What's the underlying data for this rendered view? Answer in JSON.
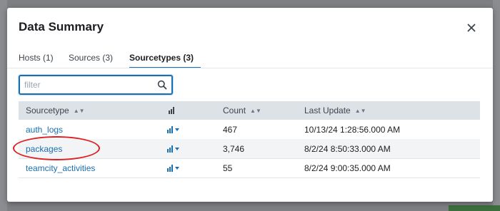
{
  "modal": {
    "title": "Data Summary",
    "tabs": [
      {
        "label": "Hosts (1)",
        "active": false
      },
      {
        "label": "Sources (3)",
        "active": false
      },
      {
        "label": "Sourcetypes (3)",
        "active": true
      }
    ],
    "filter": {
      "placeholder": "filter",
      "value": ""
    }
  },
  "table": {
    "headers": [
      "Sourcetype",
      "Count",
      "Last Update"
    ],
    "rows": [
      {
        "sourcetype": "auth_logs",
        "count": "467",
        "last_update": "10/13/24 1:28:56.000 AM"
      },
      {
        "sourcetype": "packages",
        "count": "3,746",
        "last_update": "8/2/24 8:50:33.000 AM",
        "highlighted": true
      },
      {
        "sourcetype": "teamcity_activities",
        "count": "55",
        "last_update": "8/2/24 9:00:35.000 AM"
      }
    ]
  },
  "colors": {
    "accent": "#1a6fb0",
    "highlight": "#e02020",
    "header_bg": "#dde2e7"
  },
  "icons": {
    "close": "close-icon",
    "search": "search-icon",
    "chart": "bar-chart-icon",
    "sort": "sort-icon"
  }
}
